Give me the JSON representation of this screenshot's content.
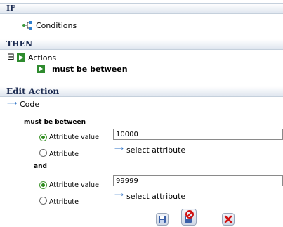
{
  "if_section": {
    "header": "IF",
    "conditions_label": "Conditions",
    "icon": "conditions-icon"
  },
  "then_section": {
    "header": "THEN",
    "actions_label": "Actions",
    "action_rule": "must be between",
    "collapse_glyph": "⊟",
    "icons": [
      "collapse-toggle-icon",
      "actions-icon",
      "action-item-icon"
    ]
  },
  "edit_action": {
    "header": "Edit Action",
    "code_label": "Code",
    "rule_label": "must be between",
    "and_label": "and",
    "first": {
      "attribute_value_label": "Attribute value",
      "attribute_label": "Attribute",
      "value": "10000",
      "select_attribute_label": "select attribute",
      "selected": "attribute_value"
    },
    "second": {
      "attribute_value_label": "Attribute value",
      "attribute_label": "Attribute",
      "value": "99999",
      "select_attribute_label": "select attribute",
      "selected": "attribute_value"
    },
    "buttons": [
      "save-icon",
      "delete-record-icon",
      "cancel-icon"
    ]
  },
  "colors": {
    "header_text": "#1b2a50",
    "header_bg": "#dfe6ef",
    "link_blue": "#2a6fc4",
    "radio_green": "#2f8c1f",
    "cancel_red": "#d01010"
  }
}
